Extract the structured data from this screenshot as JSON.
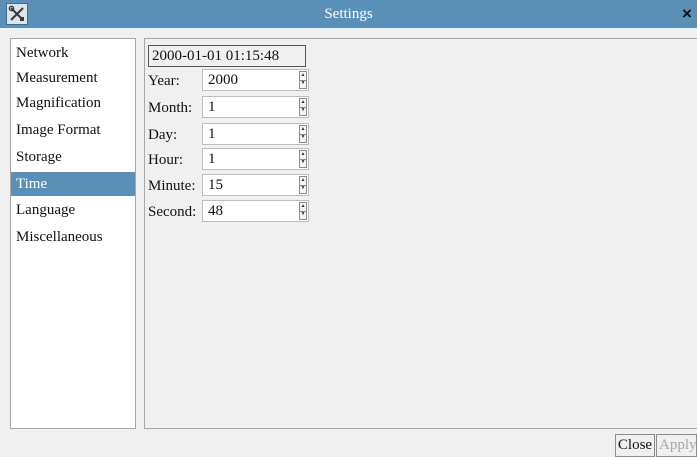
{
  "window": {
    "title": "Settings",
    "icon": "tools-icon",
    "close_glyph": "×"
  },
  "sidebar": {
    "selected": "Time",
    "items": [
      {
        "label": "Network"
      },
      {
        "label": "Measurement"
      },
      {
        "label": "Magnification"
      },
      {
        "label": "Image Format"
      },
      {
        "label": "Storage"
      },
      {
        "label": "Time"
      },
      {
        "label": "Language"
      },
      {
        "label": "Miscellaneous"
      }
    ]
  },
  "time": {
    "current_datetime": "2000-01-01 01:15:48",
    "fields": [
      {
        "label": "Year:",
        "value": "2000"
      },
      {
        "label": "Month:",
        "value": "1"
      },
      {
        "label": "Day:",
        "value": "1"
      },
      {
        "label": "Hour:",
        "value": "1"
      },
      {
        "label": "Minute:",
        "value": "15"
      },
      {
        "label": "Second:",
        "value": "48"
      }
    ],
    "spin_up_glyph": "▲",
    "spin_down_glyph": "▼"
  },
  "buttons": {
    "close_label": "Close",
    "apply_label": "Apply"
  },
  "colors": {
    "titlebar": "#5a8fb8",
    "selected_item": "#5a8fb8",
    "disabled_text": "#a8a8a8"
  }
}
